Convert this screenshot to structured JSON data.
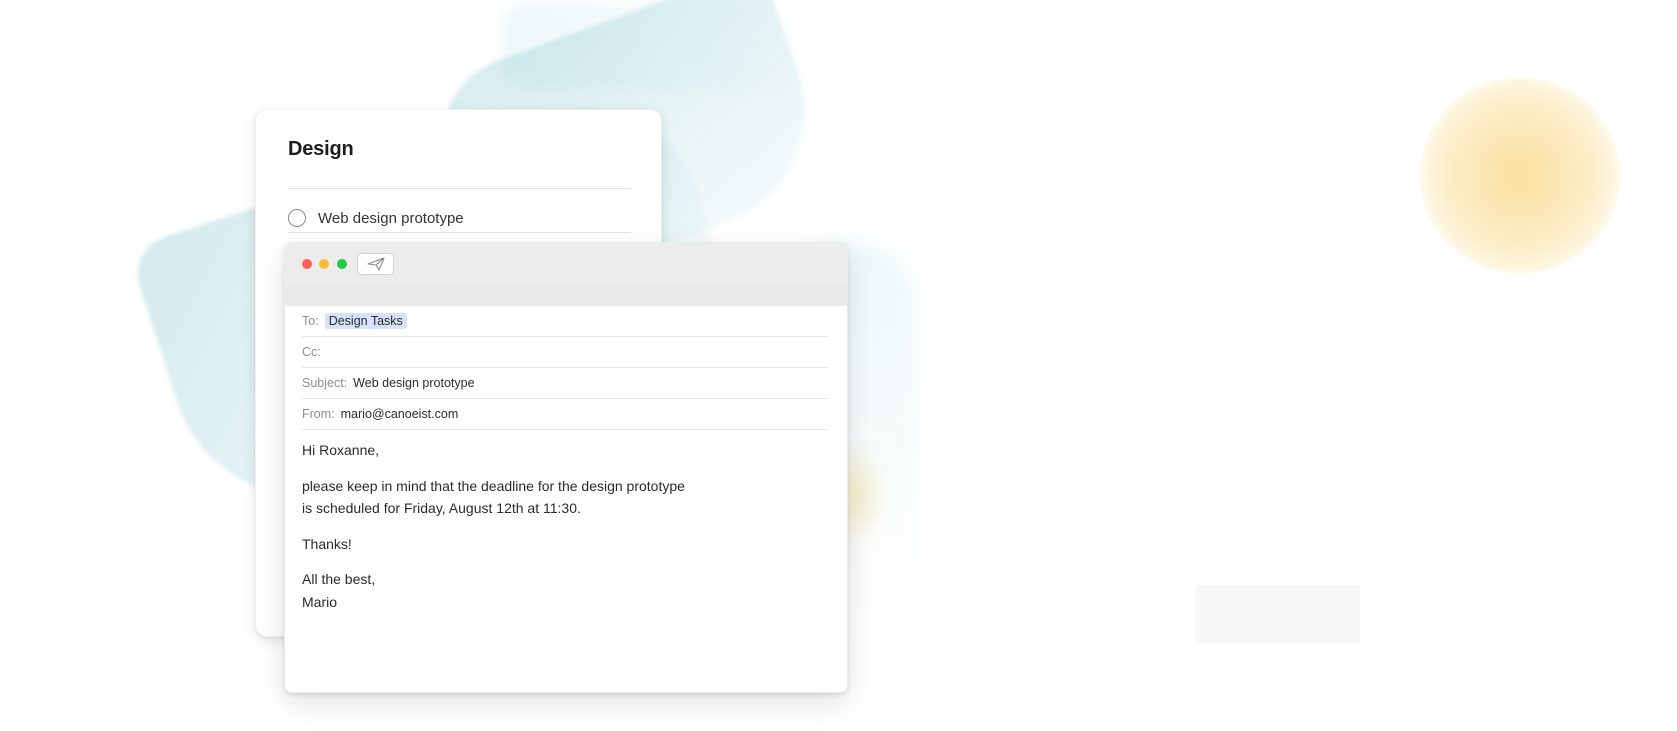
{
  "task_list": {
    "title": "Design",
    "items": [
      {
        "label": "Web design prototype",
        "done": false
      }
    ]
  },
  "mail": {
    "toolbar": {
      "send_icon": "paper-plane-icon"
    },
    "to_label": "To:",
    "to_value": "Design Tasks",
    "cc_label": "Cc:",
    "cc_value": "",
    "subject_label": "Subject:",
    "subject_value": "Web design prototype",
    "from_label": "From:",
    "from_value": "mario@canoeist.com",
    "body": {
      "greeting": "Hi Roxanne,",
      "line1": "please keep in mind that the deadline for the design prototype",
      "line2": "is scheduled for Friday, August 12th at 11:30.",
      "thanks": "Thanks!",
      "signoff": "All the best,",
      "signature": "Mario"
    }
  },
  "colors": {
    "traffic_red": "#fe5f57",
    "traffic_yellow": "#febc2e",
    "traffic_green": "#28c840",
    "recipient_token_bg": "#d5e3fa",
    "brush_blue": "#9fd0d6",
    "brush_yellow": "#f6c450"
  }
}
